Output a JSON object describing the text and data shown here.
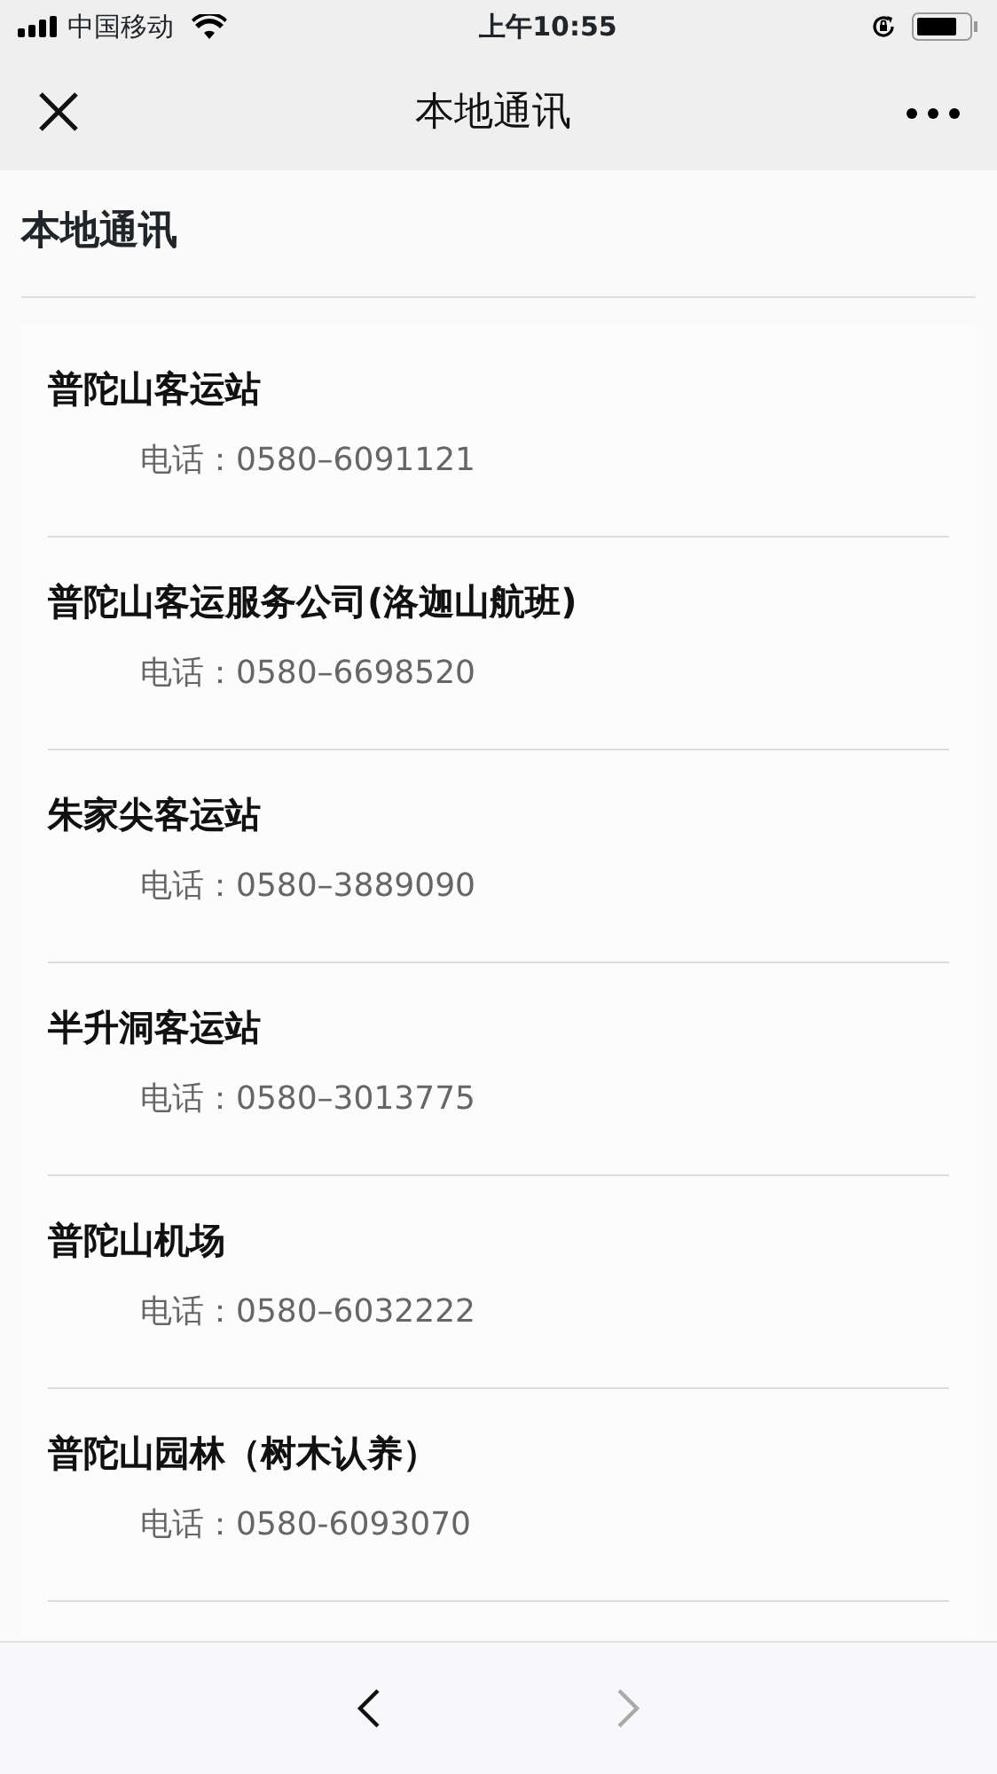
{
  "status_bar": {
    "carrier": "中国移动",
    "time": "上午10:55"
  },
  "nav": {
    "title": "本地通讯"
  },
  "heading": "本地通讯",
  "contacts": [
    {
      "name": "普陀山客运站",
      "phone": "电话：0580–6091121"
    },
    {
      "name": "普陀山客运服务公司(洛迦山航班)",
      "phone": "电话：0580–6698520"
    },
    {
      "name": "朱家尖客运站",
      "phone": "电话：0580–3889090"
    },
    {
      "name": "半升洞客运站",
      "phone": "电话：0580–3013775"
    },
    {
      "name": "普陀山机场",
      "phone": "电话：0580–6032222"
    },
    {
      "name": "普陀山园林（树木认养）",
      "phone": "电话：0580-6093070"
    }
  ],
  "toolbar": {
    "back": {
      "disabled": false
    },
    "forward": {
      "disabled": true
    }
  }
}
